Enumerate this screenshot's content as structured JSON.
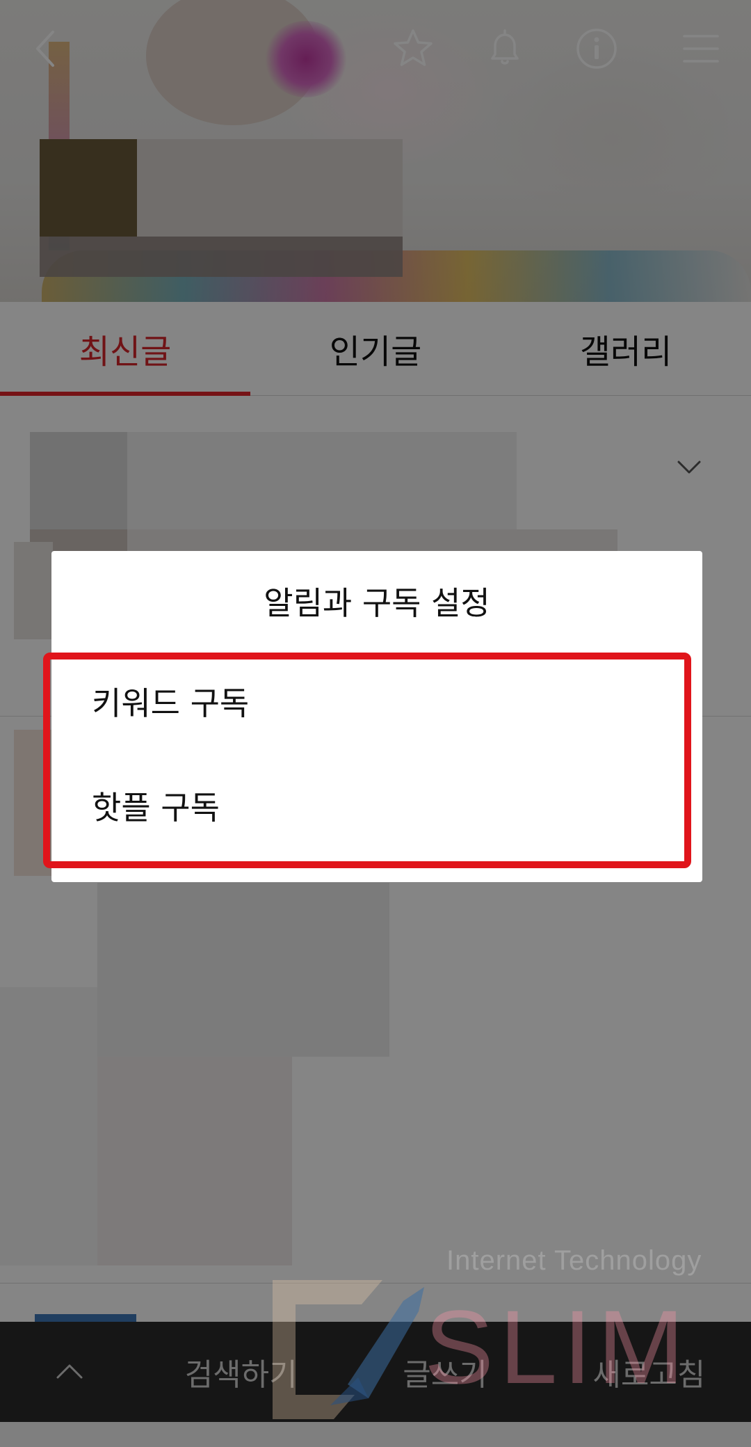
{
  "tabs": [
    {
      "label": "최신글",
      "active": true
    },
    {
      "label": "인기글",
      "active": false
    },
    {
      "label": "갤러리",
      "active": false
    }
  ],
  "header": {
    "icons": [
      "back-icon",
      "star-icon",
      "bell-icon",
      "info-icon",
      "menu-icon"
    ]
  },
  "modal": {
    "title": "알림과 구독 설정",
    "options": [
      "키워드 구독",
      "핫플 구독"
    ],
    "highlight_color": "#e0151b"
  },
  "bottom_bar": {
    "items": [
      "검색하기",
      "글쓰기",
      "새로고침"
    ]
  },
  "watermark": {
    "line1": "Internet Technology",
    "line2": "SLIM"
  },
  "colors": {
    "accent": "#d7262b",
    "bottom_bar": "#2b2b2b"
  }
}
